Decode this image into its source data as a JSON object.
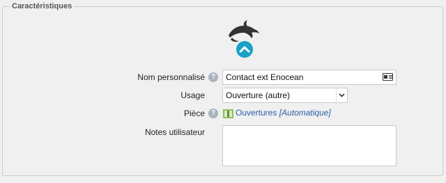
{
  "section": {
    "title": "Caractéristiques"
  },
  "logo": {
    "icon": "dolphin-icon",
    "toggle_icon": "chevron-up-icon",
    "accent": "#1ba1c5"
  },
  "fields": {
    "name": {
      "label": "Nom personnalisé",
      "value": "Contact ext Enocean",
      "icon": "contact-card-icon"
    },
    "usage": {
      "label": "Usage",
      "value": "Ouverture (autre)"
    },
    "room": {
      "label": "Pièce",
      "value": "Ouvertures",
      "suffix": "[Automatique]",
      "icon": "room-icon"
    },
    "notes": {
      "label": "Notes utilisateur",
      "value": ""
    }
  },
  "help_glyph": "?"
}
